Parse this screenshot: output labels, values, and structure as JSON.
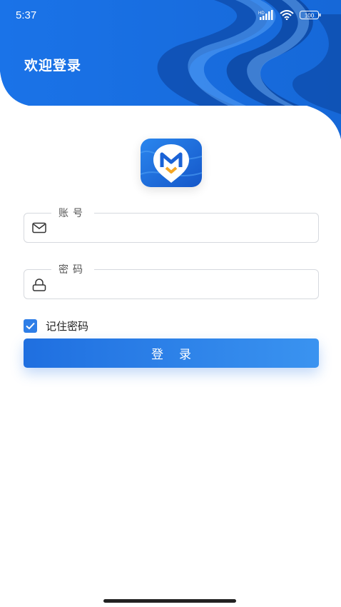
{
  "status_bar": {
    "time": "5:37",
    "battery": "100",
    "hd_label": "HD"
  },
  "header": {
    "title": "欢迎登录"
  },
  "form": {
    "account_label": "账号",
    "account_placeholder": "",
    "password_label": "密码",
    "password_placeholder": "",
    "remember_label": "记住密码",
    "remember_checked": true,
    "login_label": "登录"
  },
  "colors": {
    "brand_blue": "#1a73e8",
    "accent_blue": "#2e7ee7"
  },
  "icons": [
    "signal-icon",
    "wifi-icon",
    "battery-icon",
    "app-logo-icon",
    "mail-icon",
    "lock-icon",
    "checkmark-icon"
  ]
}
